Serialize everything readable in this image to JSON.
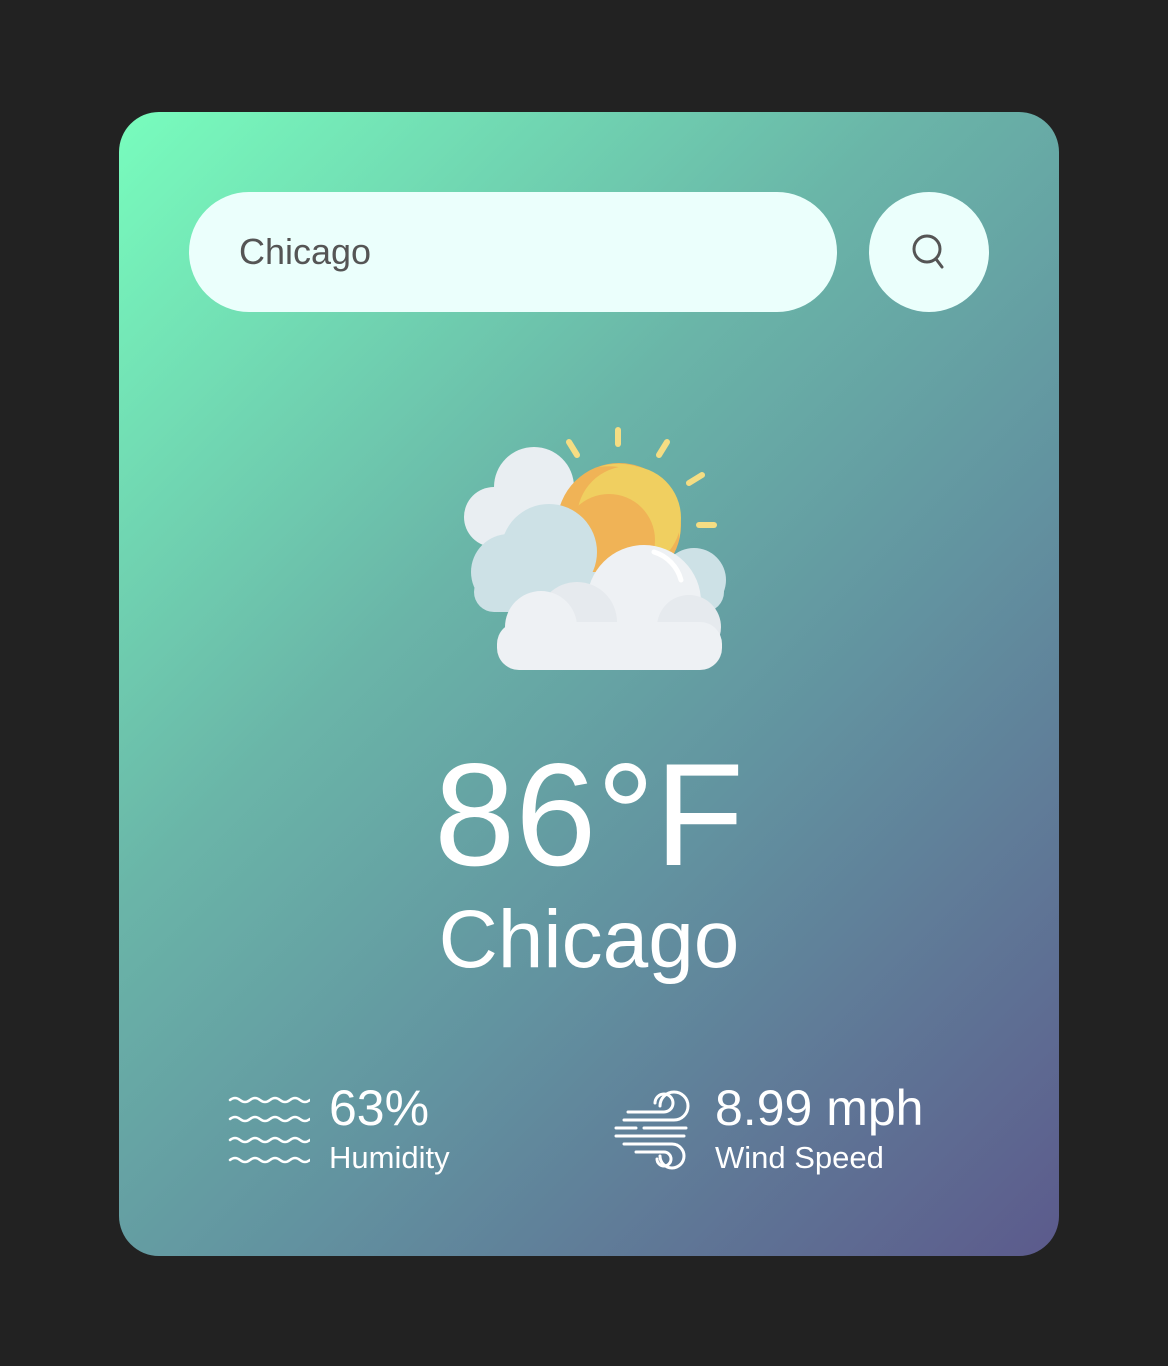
{
  "search": {
    "value": "Chicago",
    "icon": "search-icon"
  },
  "weather": {
    "icon": "partly-cloudy-icon",
    "temperature": "86°F",
    "city": "Chicago"
  },
  "details": {
    "humidity": {
      "icon": "humidity-waves-icon",
      "value": "63%",
      "label": "Humidity"
    },
    "wind": {
      "icon": "wind-icon",
      "value": "8.99 mph",
      "label": "Wind Speed"
    }
  },
  "colors": {
    "page_background": "#222222",
    "card_gradient_start": "#78fdbd",
    "card_gradient_end": "#5c5a8c",
    "search_background": "#ebfffc",
    "text": "#ffffff"
  }
}
